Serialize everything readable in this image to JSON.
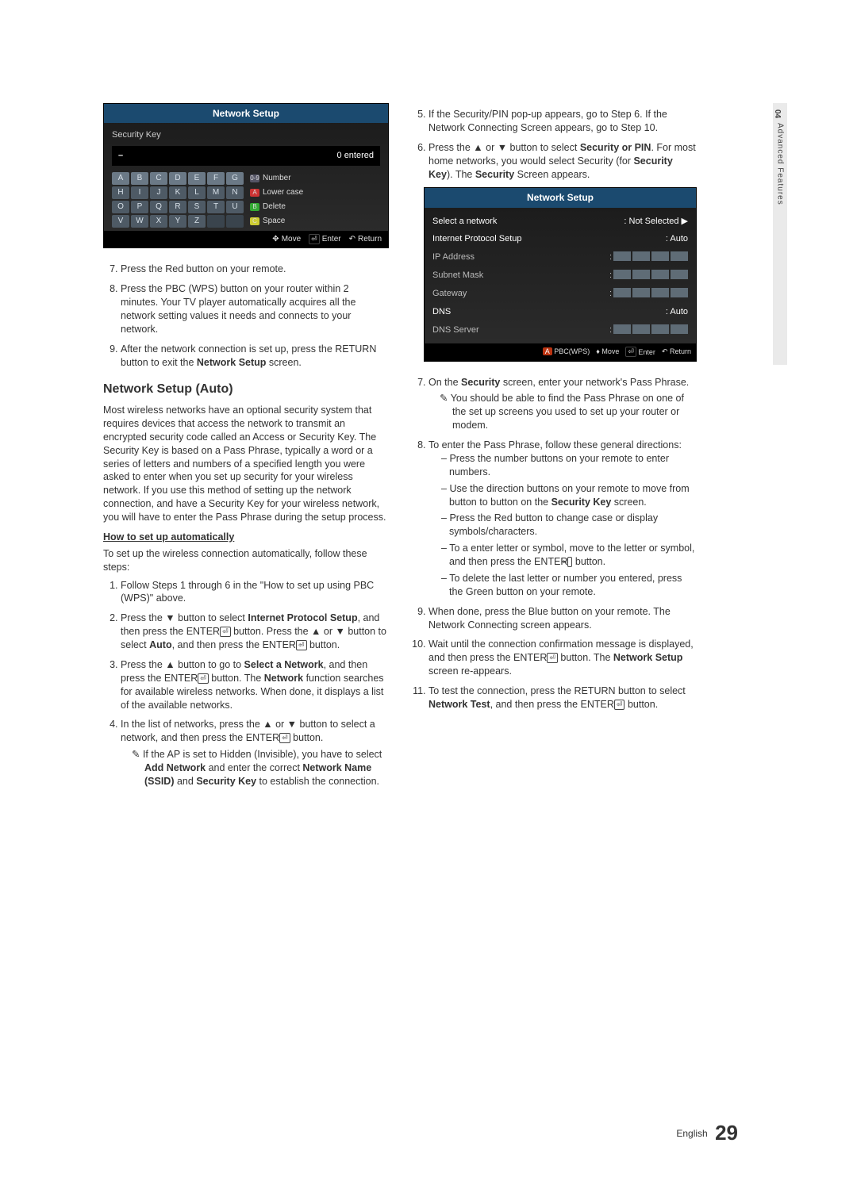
{
  "sideTab": {
    "chapter": "04",
    "label": "Advanced Features"
  },
  "kbPanel": {
    "title": "Network Setup",
    "fieldLabel": "Security Key",
    "entered": "0 entered",
    "rows": [
      [
        "A",
        "B",
        "C",
        "D",
        "E",
        "F",
        "G"
      ],
      [
        "H",
        "I",
        "J",
        "K",
        "L",
        "M",
        "N"
      ],
      [
        "O",
        "P",
        "Q",
        "R",
        "S",
        "T",
        "U"
      ],
      [
        "V",
        "W",
        "X",
        "Y",
        "Z",
        "",
        ""
      ]
    ],
    "cmds": [
      "Number",
      "Lower case",
      "Delete",
      "Space"
    ],
    "footer": {
      "move": "Move",
      "enter": "Enter",
      "ret": "Return"
    }
  },
  "leftSteps789": {
    "s7": "Press the Red button on your remote.",
    "s8": "Press the PBC (WPS) button on your router within 2 minutes. Your TV player automatically acquires all the network setting values it needs and connects to your network.",
    "s9_a": "After the network connection is set up, press the RETURN button to exit the ",
    "s9_b": "Network Setup",
    "s9_c": " screen."
  },
  "autoHeading": "Network Setup (Auto)",
  "autoIntro": "Most wireless networks have an optional security system that requires devices that access the network to transmit an encrypted security code called an Access or Security Key. The Security Key is based on a Pass Phrase, typically a word or a series of letters and numbers of a specified length you were asked to enter when you set up security for your wireless network.  If you use this method of setting up the network connection, and have a Security Key for your wireless network, you will have to enter the Pass Phrase during the setup process.",
  "howto": "How to set up automatically",
  "howtoIntro": "To set up the wireless connection automatically, follow these steps:",
  "autoSteps": {
    "s1": "Follow Steps 1 through 6 in the \"How to set up using PBC (WPS)\" above.",
    "s2_a": "Press the ▼ button to select ",
    "s2_b": "Internet Protocol Setup",
    "s2_c": ", and then press the ENTER",
    "s2_d": " button. Press the ▲ or ▼ button to select ",
    "s2_e": "Auto",
    "s2_f": ", and then press the ENTER",
    "s2_g": " button.",
    "s3_a": "Press the ▲ button to go to ",
    "s3_b": "Select a Network",
    "s3_c": ", and then press the ENTER",
    "s3_d": " button. The ",
    "s3_e": "Network",
    "s3_f": " function searches for available wireless networks. When done, it displays a list of the available networks.",
    "s4_a": "In the list of networks, press the ▲ or ▼ button to select a network, and then press the ENTER",
    "s4_b": " button.",
    "s4_note_a": "If the AP is set to Hidden (Invisible), you have to select ",
    "s4_note_b": "Add Network",
    "s4_note_c": " and enter the correct ",
    "s4_note_d": "Network Name (SSID)",
    "s4_note_e": " and ",
    "s4_note_f": "Security Key",
    "s4_note_g": " to establish the connection."
  },
  "rightTop": {
    "s5": "If the Security/PIN pop-up appears, go to Step 6. If the Network Connecting Screen appears, go to Step 10.",
    "s6_a": "Press the ▲ or ▼ button to select ",
    "s6_b": "Security or PIN",
    "s6_c": ". For most home networks, you would select Security (for ",
    "s6_d": "Security Key",
    "s6_e": "). The ",
    "s6_f": "Security",
    "s6_g": " Screen appears."
  },
  "netPanel": {
    "title": "Network Setup",
    "rows": {
      "select": "Select a network",
      "selectVal": ": Not Selected  ▶",
      "ips": "Internet Protocol Setup",
      "ipsVal": ": Auto",
      "ip": "IP Address",
      "mask": "Subnet Mask",
      "gw": "Gateway",
      "dns": "DNS",
      "dnsVal": ": Auto",
      "dserv": "DNS Server"
    },
    "footer": {
      "a": "PBC(WPS)",
      "move": "Move",
      "enter": "Enter",
      "ret": "Return"
    }
  },
  "rightSteps": {
    "s7_a": "On the ",
    "s7_b": "Security",
    "s7_c": " screen, enter your network's Pass Phrase.",
    "s7_note": "You should be able to find the Pass Phrase on one of the set up screens you used to set up your router or modem.",
    "s8": "To enter the Pass Phrase, follow these general directions:",
    "s8_b1": "Press the number buttons on your remote to enter numbers.",
    "s8_b2_a": "Use the direction buttons on your remote to move from button to button on the ",
    "s8_b2_b": "Security Key",
    "s8_b2_c": " screen.",
    "s8_b3": "Press the Red button to change case or display symbols/characters.",
    "s8_b4_a": "To a enter letter or symbol, move to the letter or symbol, and then press the ENTER",
    "s8_b4_b": " button.",
    "s8_b5": "To delete the last letter or number you entered, press the Green button on your remote.",
    "s9": "When done, press the Blue button on your remote. The Network Connecting screen appears.",
    "s10_a": "Wait until the connection confirmation message is displayed, and then press the ENTER",
    "s10_b": " button. The ",
    "s10_c": "Network Setup",
    "s10_d": " screen re-appears.",
    "s11_a": "To test the connection, press the RETURN button to select ",
    "s11_b": "Network Test",
    "s11_c": ", and then press the ENTER",
    "s11_d": " button."
  },
  "footer": {
    "lang": "English",
    "page": "29"
  }
}
